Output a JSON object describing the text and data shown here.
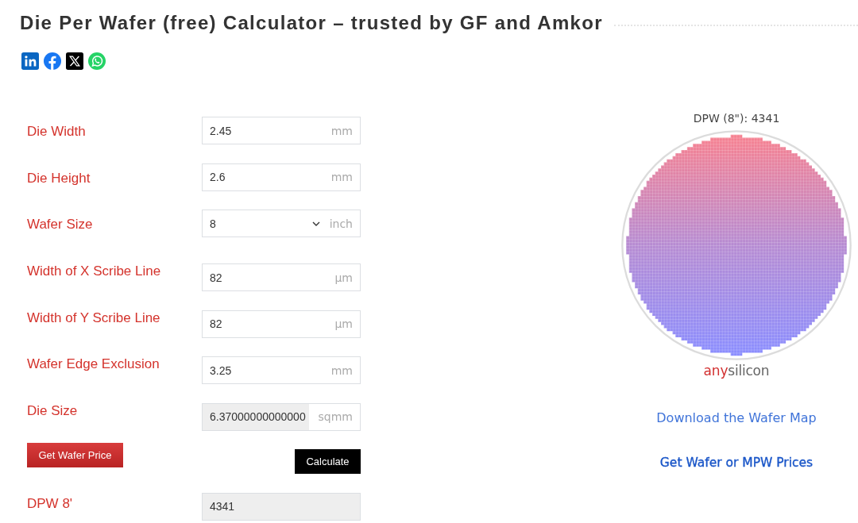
{
  "page": {
    "title": "Die Per Wafer (free) Calculator – trusted by GF and Amkor"
  },
  "calculator": {
    "fields": [
      {
        "label": "Die Width",
        "kind": "number",
        "value": "2.45",
        "unit": "mm"
      },
      {
        "label": "Die Height",
        "kind": "number",
        "value": "2.6",
        "unit": "mm"
      },
      {
        "label": "Wafer Size",
        "kind": "select",
        "value": "8",
        "unit": "inch"
      },
      {
        "label": "Width of X Scribe Line",
        "kind": "number",
        "value": "82",
        "unit": "μm"
      },
      {
        "label": "Width of Y Scribe Line",
        "kind": "number",
        "value": "82",
        "unit": "μm"
      },
      {
        "label": "Wafer Edge Exclusion",
        "kind": "number",
        "value": "3.25",
        "unit": "mm"
      },
      {
        "label": "Die Size",
        "kind": "readonly",
        "value": "6.37000000000000",
        "unit": "sqmm"
      }
    ],
    "price_button": "Get Wafer Price",
    "calculate_button": "Calculate",
    "result": {
      "label": "DPW 8'",
      "value": "4341"
    }
  },
  "wafer_panel": {
    "caption": "DPW (8\"): 4341",
    "logo": {
      "accent": "any",
      "text": "silicon"
    },
    "links": [
      {
        "label": "Download the Wafer Map",
        "kind": "plain"
      },
      {
        "label": "Get Wafer or MPW Prices",
        "kind": "bold"
      }
    ]
  }
}
